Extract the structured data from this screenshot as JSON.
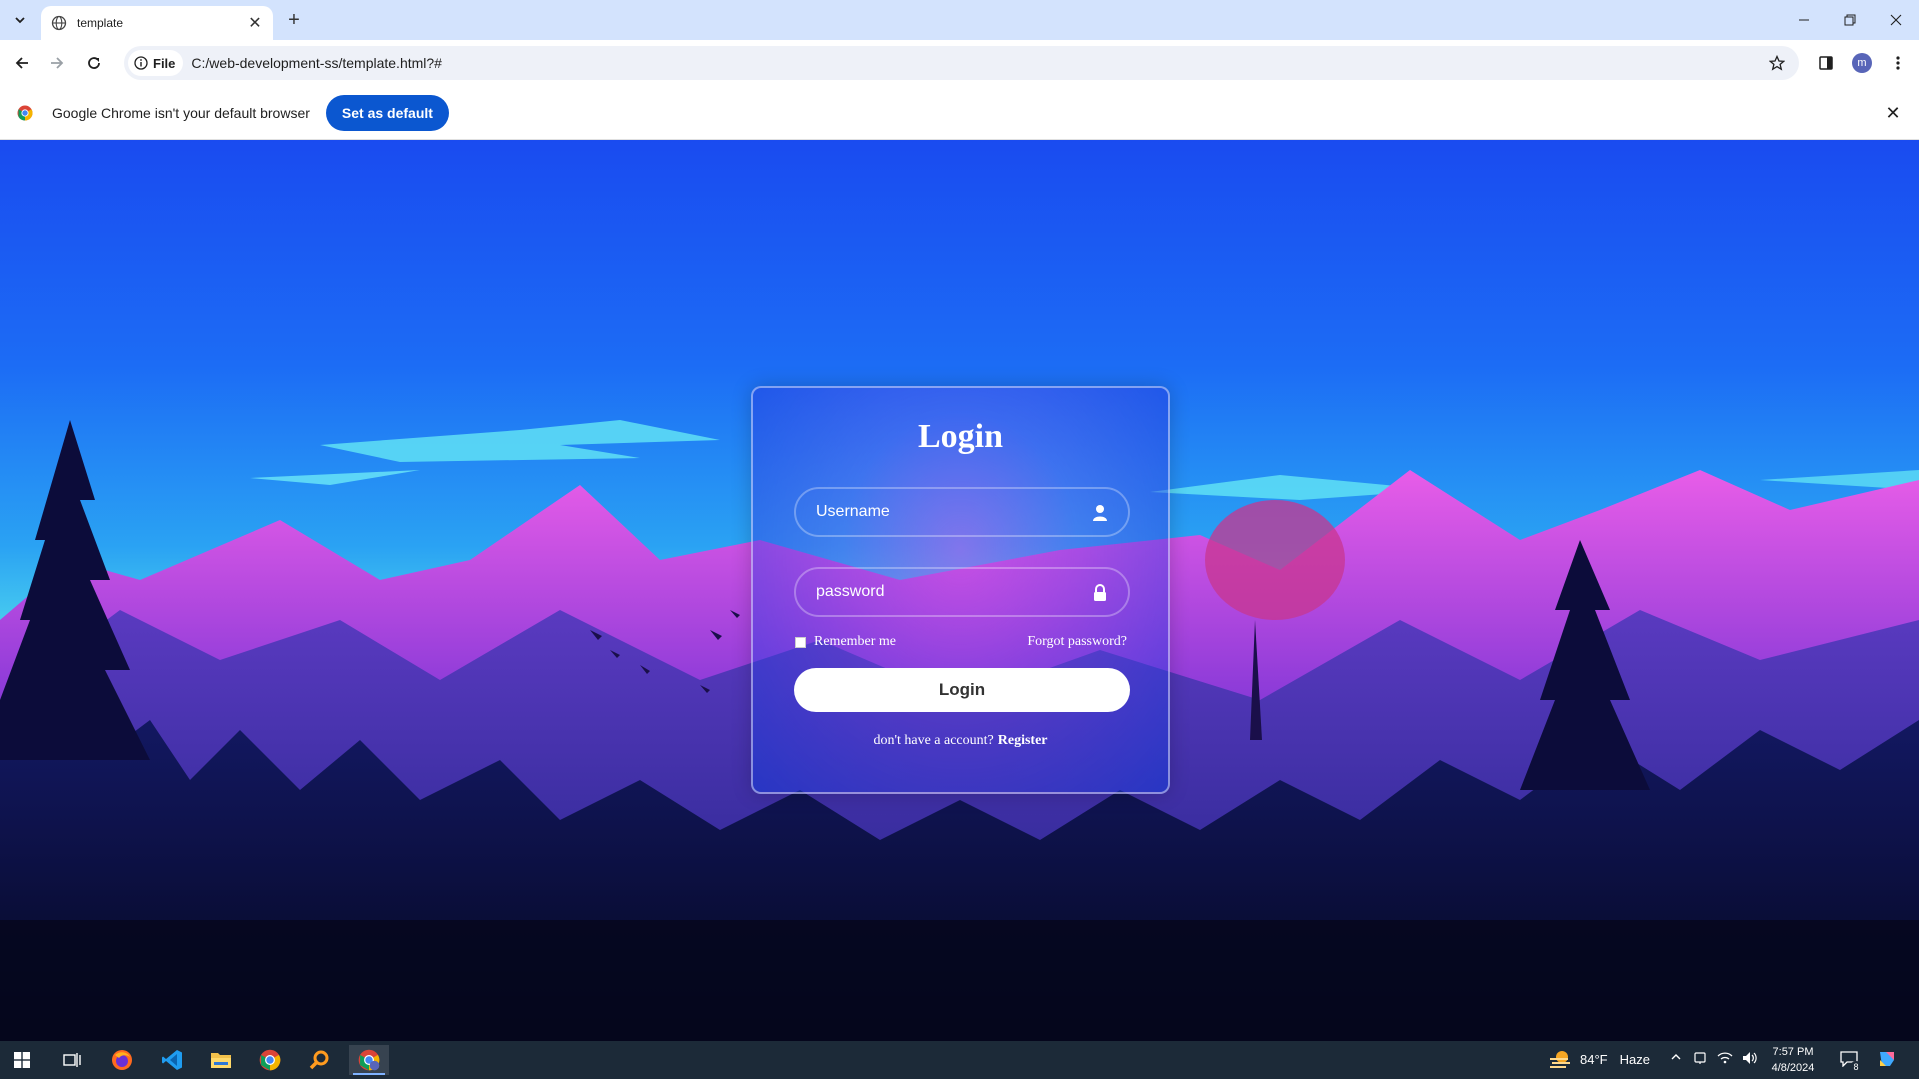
{
  "browser": {
    "tab_title": "template",
    "url_chip": "File",
    "url": "C:/web-development-ss/template.html?#",
    "avatar_letter": "m",
    "infobar_message": "Google Chrome isn't your default browser",
    "infobar_button": "Set as default"
  },
  "login": {
    "title": "Login",
    "username_placeholder": "Username",
    "password_placeholder": "password",
    "remember_label": "Remember me",
    "forgot_label": "Forgot password?",
    "button_label": "Login",
    "register_prompt": "don't have a account?",
    "register_link": "Register"
  },
  "taskbar": {
    "weather_temp": "84°F",
    "weather_desc": "Haze",
    "time": "7:57 PM",
    "date": "4/8/2024",
    "notification_count": "8"
  },
  "colors": {
    "chrome_tabstrip": "#d3e3fd",
    "infobar_button": "#0b57d0",
    "taskbar": "#1c2a38"
  }
}
